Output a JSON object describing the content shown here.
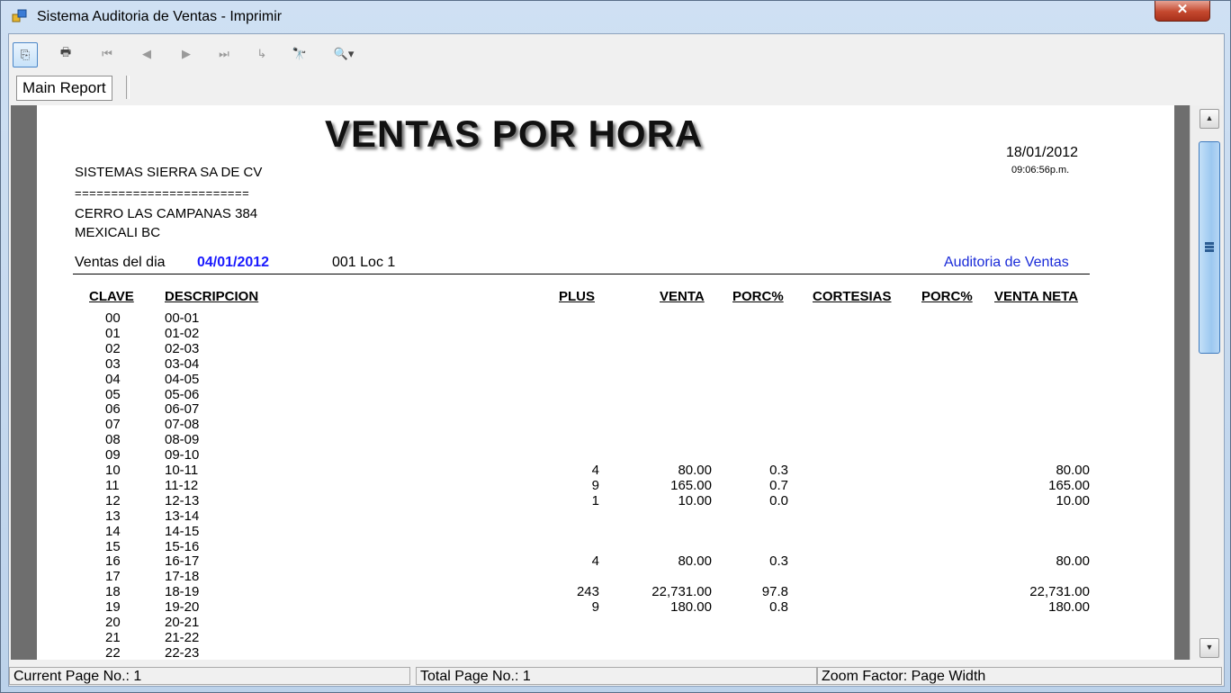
{
  "window": {
    "title": "Sistema Auditoria de Ventas - Imprimir",
    "close_glyph": "✕"
  },
  "toolbar": {
    "buttons": [
      {
        "name": "export-icon",
        "glyph": "⎘"
      },
      {
        "name": "print-icon",
        "glyph": "🖶"
      },
      {
        "name": "first-page-icon",
        "glyph": "⏮"
      },
      {
        "name": "prev-page-icon",
        "glyph": "◀"
      },
      {
        "name": "next-page-icon",
        "glyph": "▶"
      },
      {
        "name": "last-page-icon",
        "glyph": "⏭"
      },
      {
        "name": "goto-page-icon",
        "glyph": "↳"
      },
      {
        "name": "find-icon",
        "glyph": "🔭"
      },
      {
        "name": "zoom-icon",
        "glyph": "🔍▾"
      }
    ]
  },
  "tabs": {
    "main": "Main Report"
  },
  "report": {
    "title": "VENTAS POR HORA",
    "date": "18/01/2012",
    "time": "09:06:56p.m.",
    "company": "SISTEMAS SIERRA SA DE CV",
    "separator": "========================",
    "address1": "CERRO LAS CAMPANAS 384",
    "address2": "MEXICALI BC",
    "ventas_label": "Ventas del dia",
    "ventas_date": "04/01/2012",
    "location": "001 Loc 1",
    "audit_link": "Auditoria de Ventas",
    "headers": {
      "clave": "CLAVE",
      "descripcion": "DESCRIPCION",
      "plus": "PLUS",
      "venta": "VENTA",
      "porc1": "PORC%",
      "cortesias": "CORTESIAS",
      "porc2": "PORC%",
      "venta_neta": "VENTA NETA"
    },
    "rows": [
      {
        "clave": "00",
        "desc": "00-01",
        "plus": "",
        "venta": "",
        "porc": "",
        "neta": ""
      },
      {
        "clave": "01",
        "desc": "01-02",
        "plus": "",
        "venta": "",
        "porc": "",
        "neta": ""
      },
      {
        "clave": "02",
        "desc": "02-03",
        "plus": "",
        "venta": "",
        "porc": "",
        "neta": ""
      },
      {
        "clave": "03",
        "desc": "03-04",
        "plus": "",
        "venta": "",
        "porc": "",
        "neta": ""
      },
      {
        "clave": "04",
        "desc": "04-05",
        "plus": "",
        "venta": "",
        "porc": "",
        "neta": ""
      },
      {
        "clave": "05",
        "desc": "05-06",
        "plus": "",
        "venta": "",
        "porc": "",
        "neta": ""
      },
      {
        "clave": "06",
        "desc": "06-07",
        "plus": "",
        "venta": "",
        "porc": "",
        "neta": ""
      },
      {
        "clave": "07",
        "desc": "07-08",
        "plus": "",
        "venta": "",
        "porc": "",
        "neta": ""
      },
      {
        "clave": "08",
        "desc": "08-09",
        "plus": "",
        "venta": "",
        "porc": "",
        "neta": ""
      },
      {
        "clave": "09",
        "desc": "09-10",
        "plus": "",
        "venta": "",
        "porc": "",
        "neta": ""
      },
      {
        "clave": "10",
        "desc": "10-11",
        "plus": "4",
        "venta": "80.00",
        "porc": "0.3",
        "neta": "80.00"
      },
      {
        "clave": "11",
        "desc": "11-12",
        "plus": "9",
        "venta": "165.00",
        "porc": "0.7",
        "neta": "165.00"
      },
      {
        "clave": "12",
        "desc": "12-13",
        "plus": "1",
        "venta": "10.00",
        "porc": "0.0",
        "neta": "10.00"
      },
      {
        "clave": "13",
        "desc": "13-14",
        "plus": "",
        "venta": "",
        "porc": "",
        "neta": ""
      },
      {
        "clave": "14",
        "desc": "14-15",
        "plus": "",
        "venta": "",
        "porc": "",
        "neta": ""
      },
      {
        "clave": "15",
        "desc": "15-16",
        "plus": "",
        "venta": "",
        "porc": "",
        "neta": ""
      },
      {
        "clave": "16",
        "desc": "16-17",
        "plus": "4",
        "venta": "80.00",
        "porc": "0.3",
        "neta": "80.00"
      },
      {
        "clave": "17",
        "desc": "17-18",
        "plus": "",
        "venta": "",
        "porc": "",
        "neta": ""
      },
      {
        "clave": "18",
        "desc": "18-19",
        "plus": "243",
        "venta": "22,731.00",
        "porc": "97.8",
        "neta": "22,731.00"
      },
      {
        "clave": "19",
        "desc": "19-20",
        "plus": "9",
        "venta": "180.00",
        "porc": "0.8",
        "neta": "180.00"
      },
      {
        "clave": "20",
        "desc": "20-21",
        "plus": "",
        "venta": "",
        "porc": "",
        "neta": ""
      },
      {
        "clave": "21",
        "desc": "21-22",
        "plus": "",
        "venta": "",
        "porc": "",
        "neta": ""
      },
      {
        "clave": "22",
        "desc": "22-23",
        "plus": "",
        "venta": "",
        "porc": "",
        "neta": ""
      }
    ]
  },
  "status": {
    "current_page": "Current Page No.: 1",
    "total_page": "Total Page No.: 1",
    "zoom": "Zoom Factor: Page Width"
  }
}
